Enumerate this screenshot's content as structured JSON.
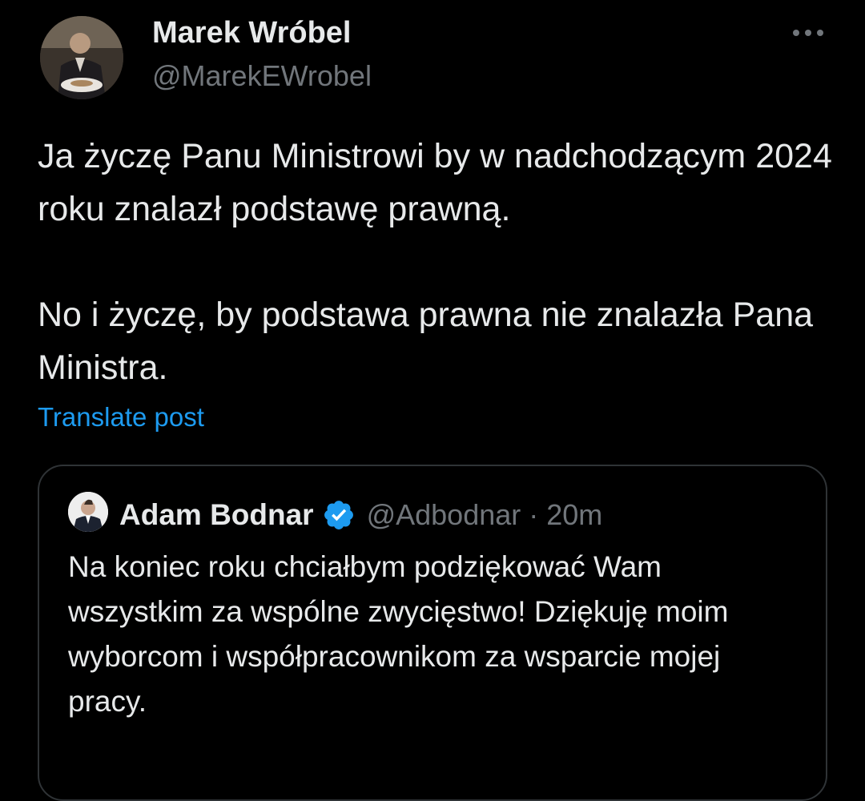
{
  "post": {
    "author": {
      "name": "Marek Wróbel",
      "handle": "@MarekEWrobel",
      "avatar_icon": "user-photo-avatar"
    },
    "more_icon": "more-horizontal-icon",
    "text_paragraphs": [
      "Ja życzę Panu Ministrowi by w nadchodzącym 2024 roku znalazł podstawę prawną.",
      "No i życzę, by podstawa prawna nie znalazła Pana Ministra."
    ],
    "translate_label": "Translate post"
  },
  "quoted_post": {
    "author": {
      "name": "Adam Bodnar",
      "handle": "@Adbodnar",
      "verified": true,
      "avatar_icon": "user-photo-avatar"
    },
    "separator": "·",
    "time": "20m",
    "text": "Na koniec roku chciałbym podziękować Wam wszystkim za wspólne zwycięstwo! Dziękuję moim wyborcom i współpracownikom za wsparcie mojej pracy."
  },
  "colors": {
    "background": "#000000",
    "primary_text": "#e7e9ea",
    "secondary_text": "#71767b",
    "link": "#1d9bf0",
    "border": "#2f3336",
    "verified": "#1d9bf0"
  }
}
